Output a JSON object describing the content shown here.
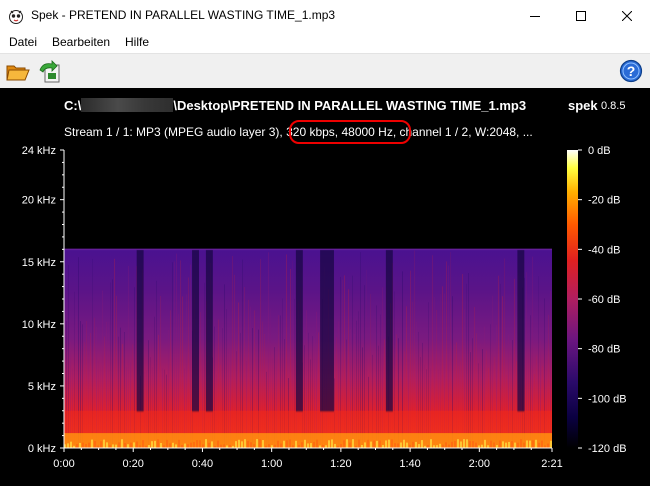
{
  "window": {
    "title": "Spek - PRETEND IN PARALLEL WASTING TIME_1.mp3",
    "app_icon": "spek-app-icon",
    "controls": [
      "minimize-icon",
      "maximize-icon",
      "close-icon"
    ]
  },
  "menu": {
    "items": [
      {
        "label": "Datei"
      },
      {
        "label": "Bearbeiten"
      },
      {
        "label": "Hilfe"
      }
    ]
  },
  "toolbar": {
    "buttons": [
      {
        "icon": "open-folder-icon"
      },
      {
        "icon": "save-export-icon"
      }
    ],
    "help_icon": "help-icon"
  },
  "header": {
    "path_prefix": "C:\\",
    "path_suffix": "\\Desktop\\PRETEND IN PARALLEL WASTING TIME_1.mp3",
    "app_name": "spek",
    "version": "0.8.5",
    "stream_info_before": "Stream 1 / 1: MP3 (MPEG audio layer 3), ",
    "stream_info_highlight": "320 kbps, 48000 Hz",
    "stream_info_after": ", channel 1 / 2, W:2048, ..."
  },
  "colors": {
    "background": "#000000",
    "highlight_ring": "#ee0000",
    "palette": [
      "#000000",
      "#0a0040",
      "#2a0a6a",
      "#6a1580",
      "#b01e60",
      "#e02020",
      "#ff5a00",
      "#ffb000",
      "#ffff40",
      "#ffffff"
    ]
  },
  "chart_data": {
    "type": "heatmap",
    "title": "",
    "xlabel": "",
    "ylabel": "",
    "x_unit": "time (m:ss)",
    "y_unit": "kHz",
    "xlim": [
      0,
      141
    ],
    "ylim": [
      0,
      24
    ],
    "x_ticks": [
      {
        "value": 0,
        "label": "0:00"
      },
      {
        "value": 20,
        "label": "0:20"
      },
      {
        "value": 40,
        "label": "0:40"
      },
      {
        "value": 60,
        "label": "1:00"
      },
      {
        "value": 80,
        "label": "1:20"
      },
      {
        "value": 100,
        "label": "1:40"
      },
      {
        "value": 120,
        "label": "2:00"
      },
      {
        "value": 141,
        "label": "2:21"
      }
    ],
    "y_ticks": [
      {
        "value": 0,
        "label": "0 kHz"
      },
      {
        "value": 5,
        "label": "5 kHz"
      },
      {
        "value": 10,
        "label": "10 kHz"
      },
      {
        "value": 15,
        "label": "15 kHz"
      },
      {
        "value": 20,
        "label": "20 kHz"
      },
      {
        "value": 24,
        "label": "24 kHz"
      }
    ],
    "colorbar": {
      "range_db": [
        -120,
        0
      ],
      "ticks": [
        {
          "value": 0,
          "label": "0 dB"
        },
        {
          "value": -20,
          "label": "-20 dB"
        },
        {
          "value": -40,
          "label": "-40 dB"
        },
        {
          "value": -60,
          "label": "-60 dB"
        },
        {
          "value": -80,
          "label": "-80 dB"
        },
        {
          "value": -100,
          "label": "-100 dB"
        },
        {
          "value": -120,
          "label": "-120 dB"
        }
      ]
    },
    "cutoff_khz": 16,
    "quiet_regions_s": [
      [
        21,
        23
      ],
      [
        37,
        39
      ],
      [
        41,
        43
      ],
      [
        67,
        69
      ],
      [
        74,
        78
      ],
      [
        93,
        95
      ],
      [
        131,
        133
      ]
    ]
  }
}
